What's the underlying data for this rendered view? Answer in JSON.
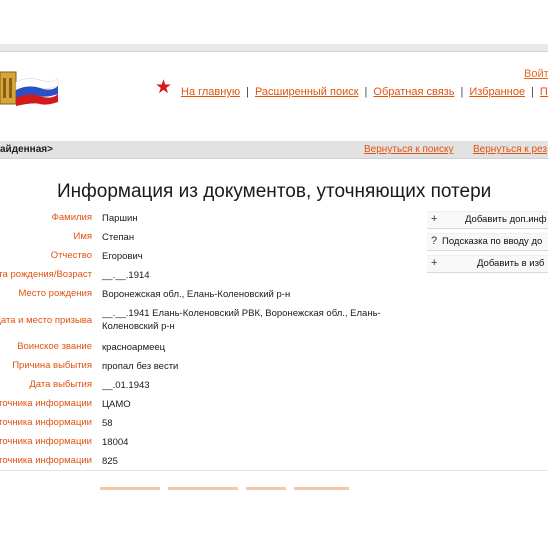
{
  "header": {
    "login_label": "Войт",
    "nav": [
      "На главную",
      "Расширенный поиск",
      "Обратная связь",
      "Избранное",
      "Пом"
    ]
  },
  "breadcrumb": {
    "current": "айденная>",
    "back_links": [
      "Вернуться к поиску",
      "Вернуться к рез"
    ]
  },
  "page": {
    "title": "Информация из документов, уточняющих потери"
  },
  "record": {
    "fields": [
      {
        "label": "Фамилия",
        "value": "Паршин"
      },
      {
        "label": "Имя",
        "value": "Степан"
      },
      {
        "label": "Отчество",
        "value": "Егорович"
      },
      {
        "label": "та рождения/Возраст",
        "value": "__.__.1914"
      },
      {
        "label": "Место рождения",
        "value": "Воронежская обл., Елань-Коленовский р-н"
      },
      {
        "label": "Дата и место призыва",
        "value": "__.__.1941 Елань-Коленовский РВК, Воронежская обл., Елань-Коленовский р-н"
      },
      {
        "label": "Воинское звание",
        "value": "красноармеец"
      },
      {
        "label": "Причина выбытия",
        "value": "пропал без вести"
      },
      {
        "label": "Дата выбытия",
        "value": "__.01.1943"
      },
      {
        "label": "точника информации",
        "value": "ЦАМО"
      },
      {
        "label": "точника информации",
        "value": "58"
      },
      {
        "label": "точника информации",
        "value": "18004"
      },
      {
        "label": "точника информации",
        "value": "825"
      }
    ]
  },
  "actions": [
    {
      "icon": "+",
      "label": "Добавить доп.инф"
    },
    {
      "icon": "?",
      "label": "Подсказка по вводу до"
    },
    {
      "icon": "+",
      "label": "Добавить в изб"
    }
  ],
  "colors": {
    "accent": "#e2520e",
    "star": "#d21a1a",
    "crumb_bg": "#e2e2e2"
  },
  "icons": [
    "site-logo-icon",
    "red-star-icon",
    "plus-icon",
    "question-icon"
  ]
}
